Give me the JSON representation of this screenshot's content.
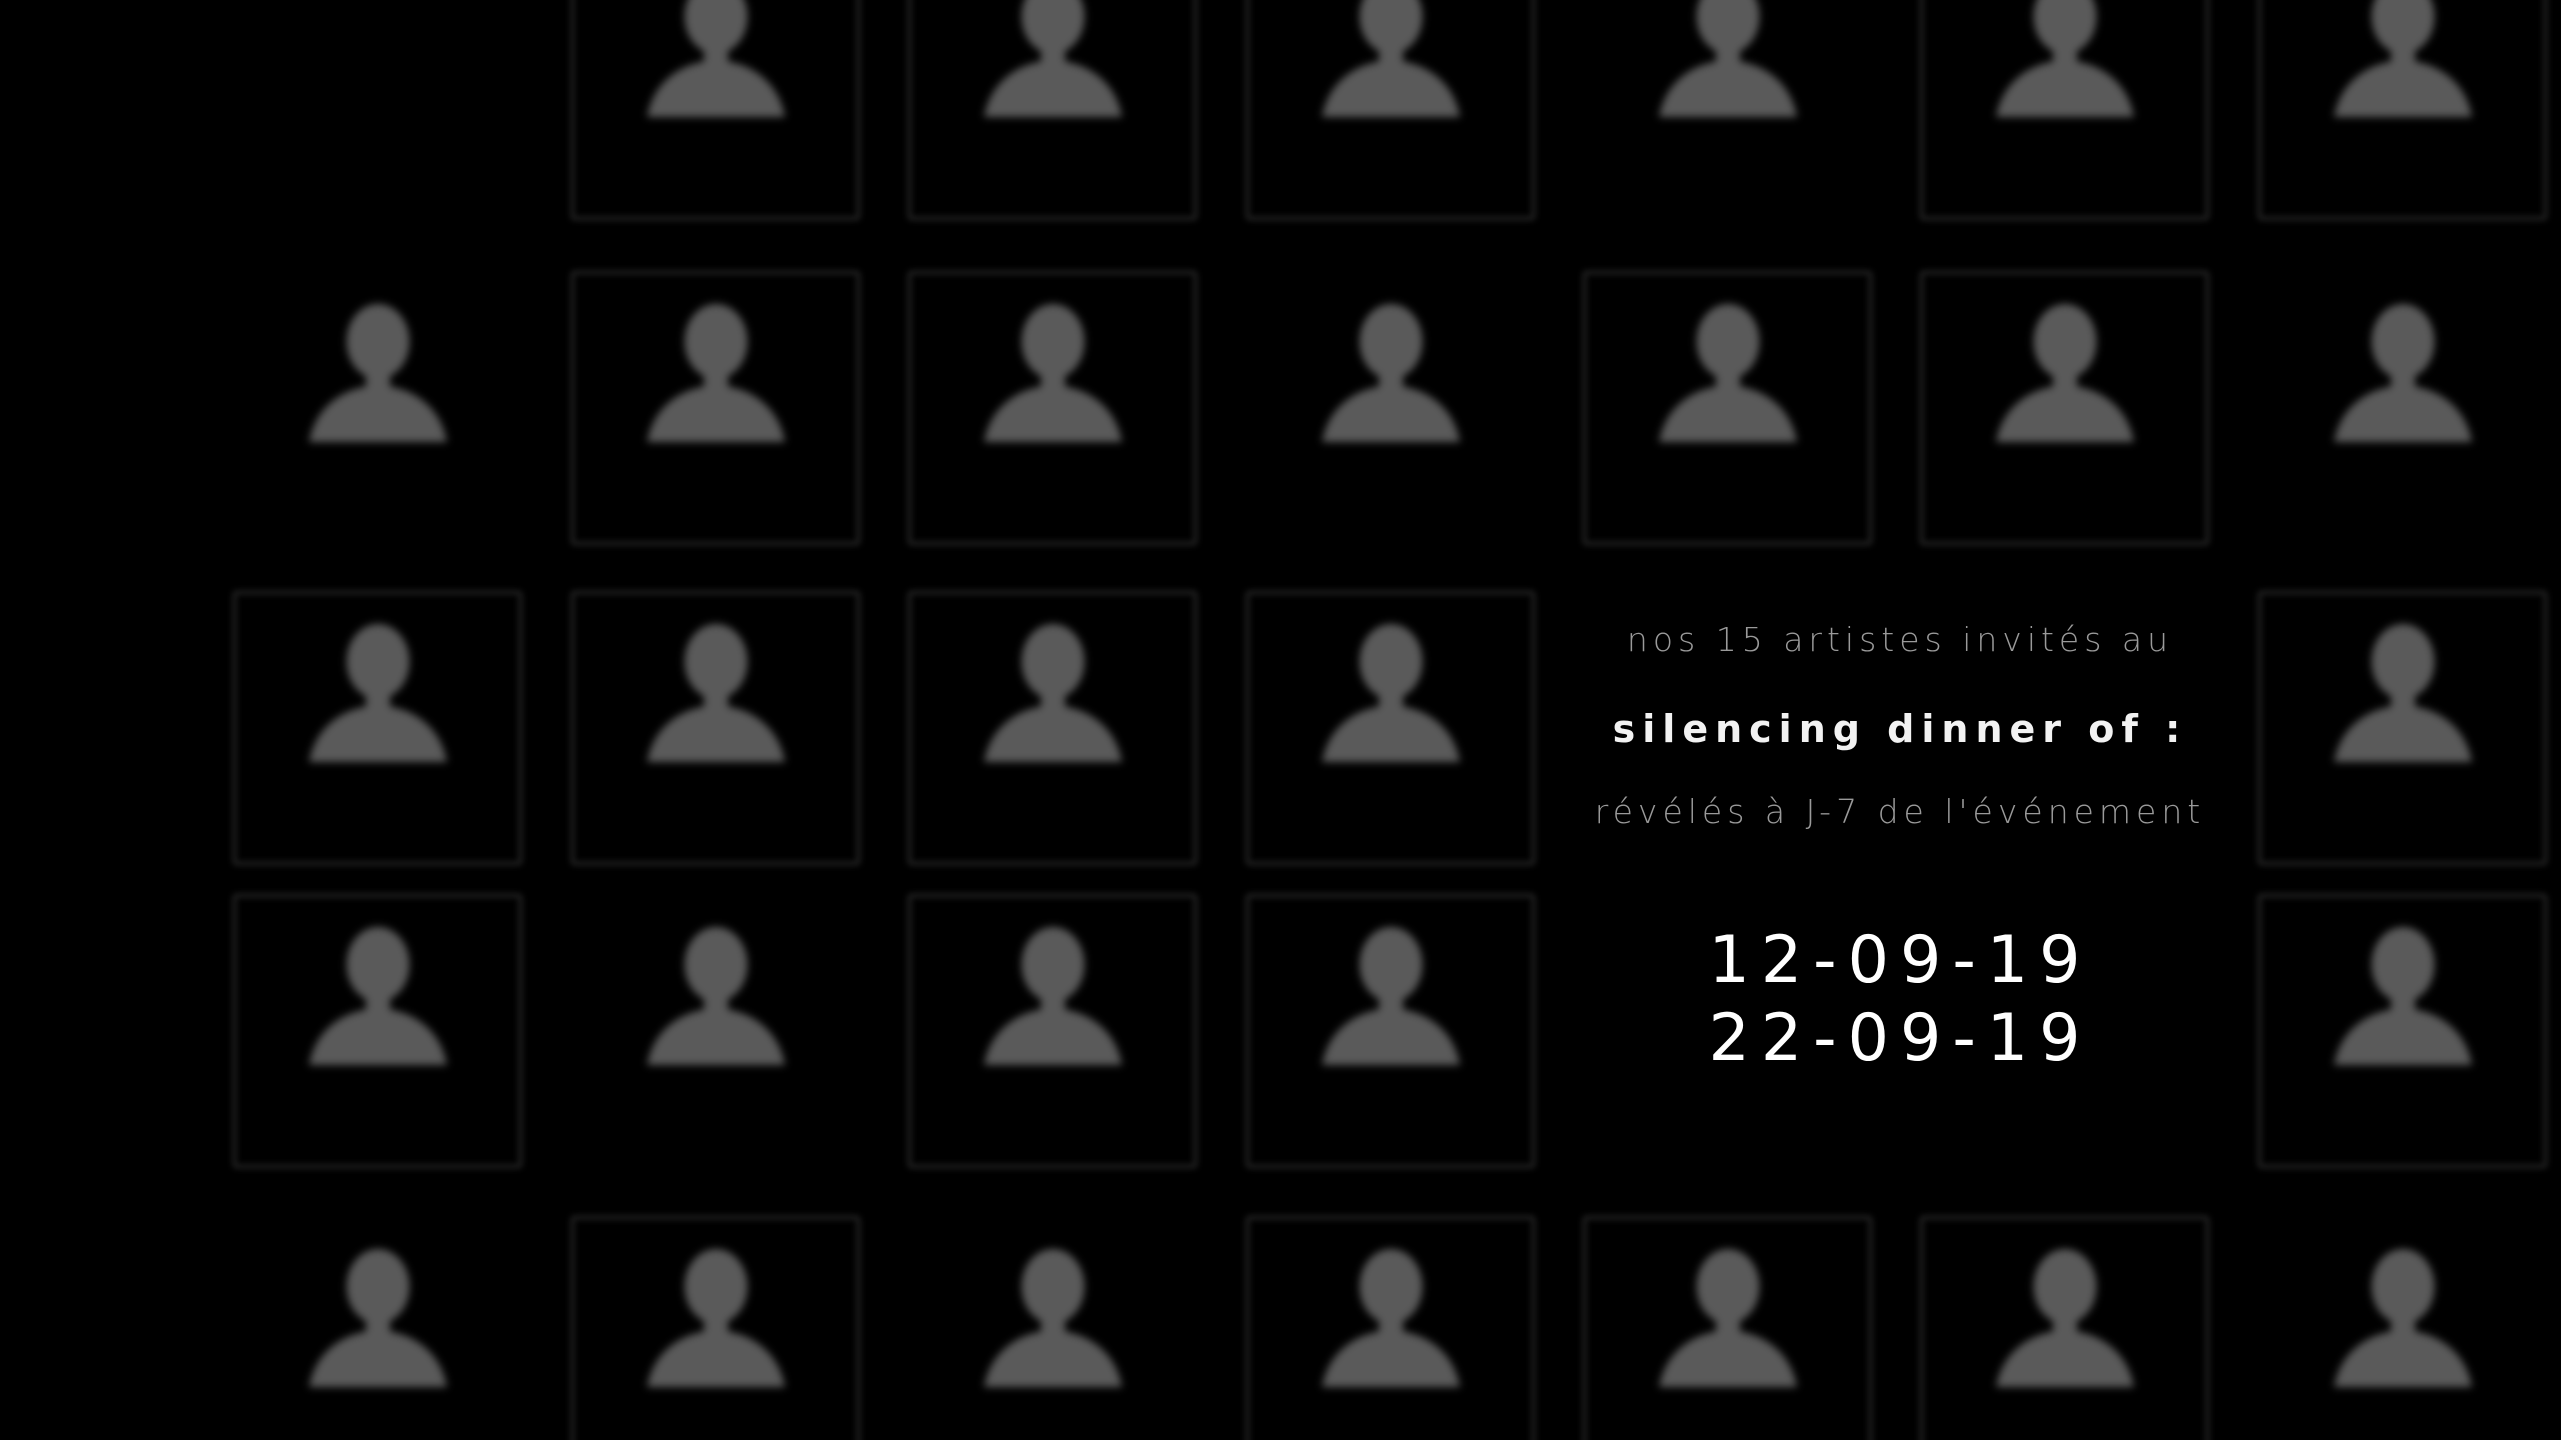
{
  "background_color": "#000000",
  "silhouette_color": "#5a5a5a",
  "frame_color": "#1c1c1c",
  "placeholder_icon": "user-silhouette-icon",
  "info": {
    "intro": "nos 15 artistes invités au",
    "event_name": "silencing dinner of :",
    "reveal_note": "révélés à J-7 de l'événement",
    "date_start": "12-09-19",
    "date_end": "22-09-19"
  },
  "grid": {
    "rows": [
      [
        "empty",
        "framed",
        "framed",
        "framed",
        "plain",
        "framed",
        "framed"
      ],
      [
        "plain",
        "framed",
        "framed",
        "plain",
        "framed",
        "framed",
        "plain"
      ],
      [
        "framed",
        "framed",
        "framed",
        "framed",
        "info",
        "info",
        "framed"
      ],
      [
        "framed",
        "plain",
        "framed",
        "framed",
        "info",
        "info",
        "framed"
      ],
      [
        "plain",
        "framed",
        "plain",
        "framed",
        "framed",
        "framed",
        "plain"
      ]
    ]
  }
}
